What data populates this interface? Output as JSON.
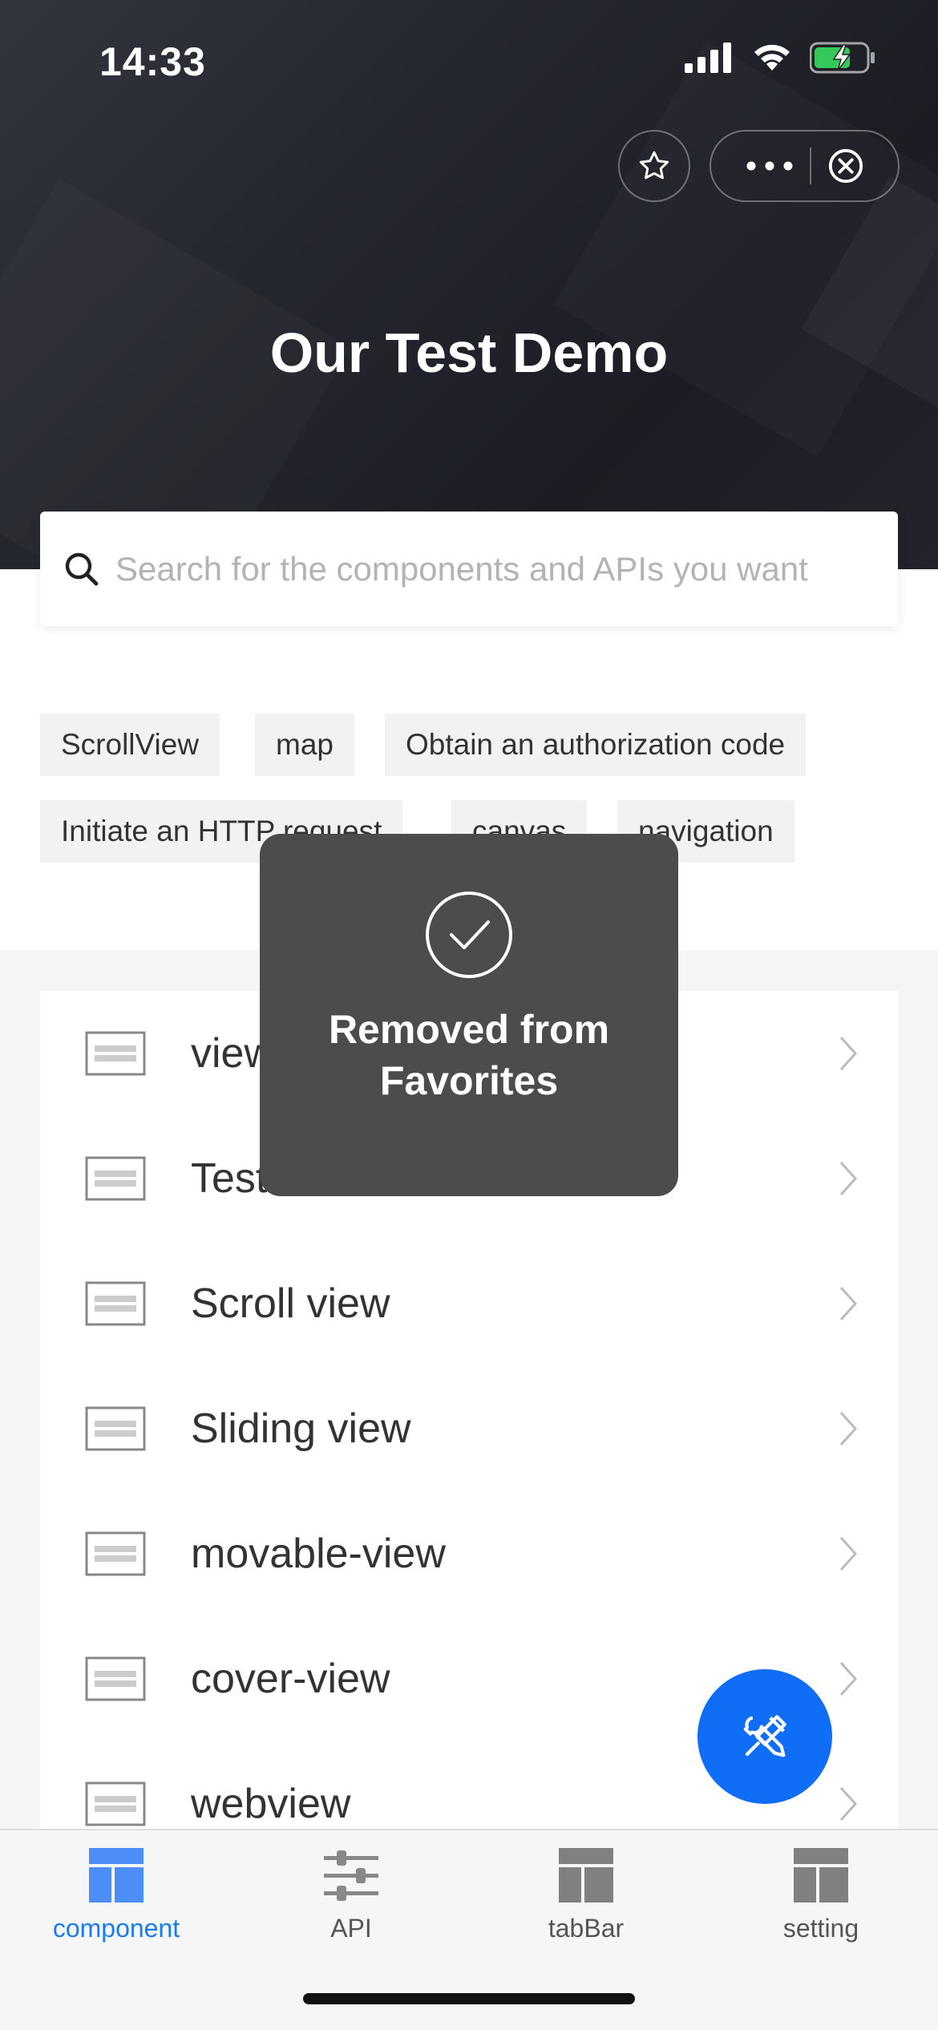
{
  "status_bar": {
    "time": "14:33"
  },
  "header": {
    "title": "Our Test Demo"
  },
  "search": {
    "placeholder": "Search for the components and APIs you want"
  },
  "tags": [
    "ScrollView",
    "map",
    "Obtain an authorization code",
    "Initiate an HTTP request",
    "canvas",
    "navigation"
  ],
  "list": [
    "view",
    "TestView",
    "Scroll view",
    "Sliding view",
    "movable-view",
    "cover-view",
    "webview"
  ],
  "toast": {
    "message": "Removed from Favorites"
  },
  "tabbar": {
    "items": [
      {
        "label": "component",
        "active": true
      },
      {
        "label": "API",
        "active": false
      },
      {
        "label": "tabBar",
        "active": false
      },
      {
        "label": "setting",
        "active": false
      }
    ]
  },
  "colors": {
    "accent": "#1a7cf0",
    "fab": "#0f6ef5",
    "header_dark": "#1c1d24",
    "toast_bg": "#4c4c4c"
  }
}
